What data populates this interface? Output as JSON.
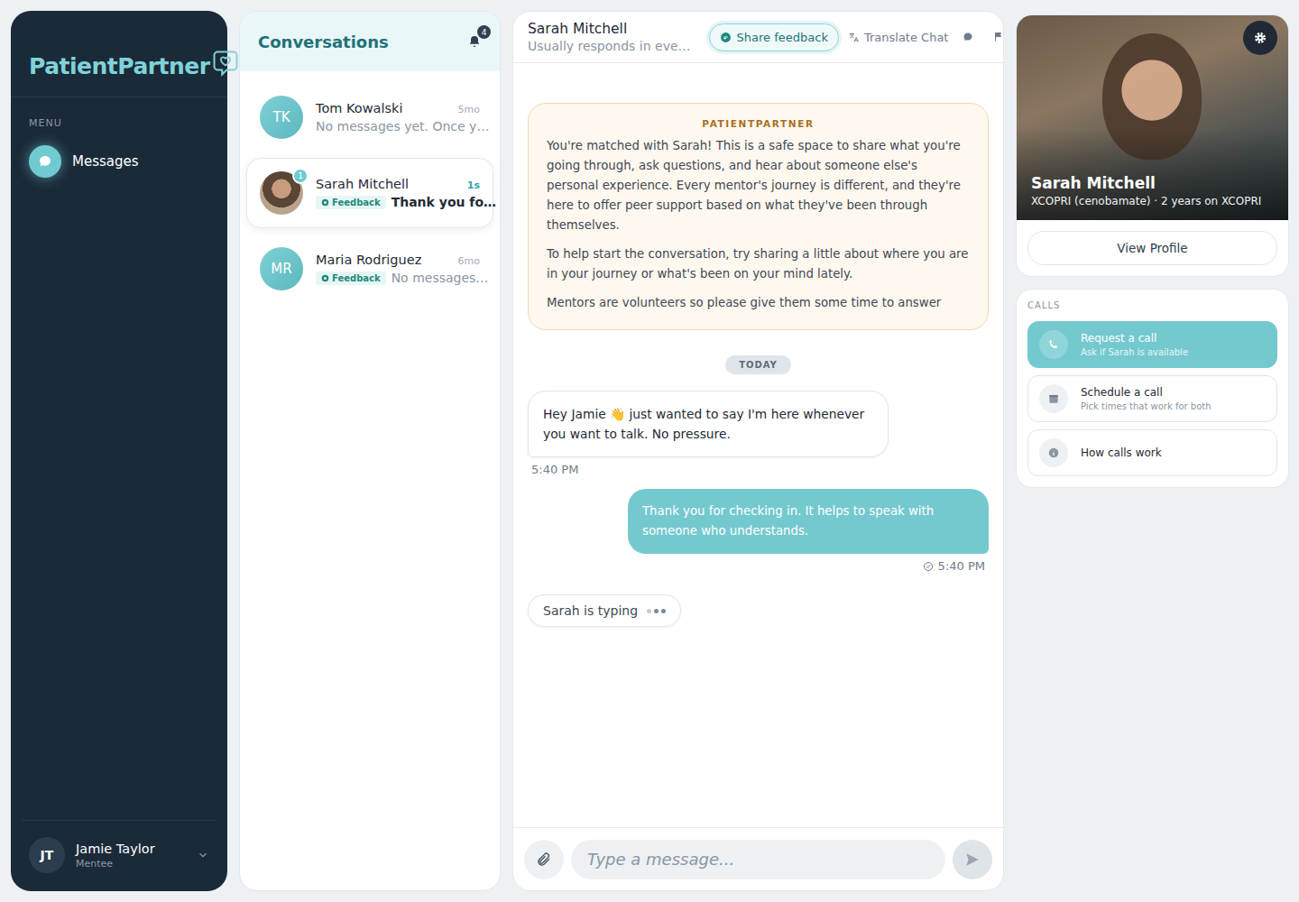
{
  "logo": "PatientPartner",
  "sidebar": {
    "menu_label": "MENU",
    "items": [
      {
        "label": "Messages",
        "selected": true
      }
    ],
    "user": {
      "initials": "JT",
      "name": "Jamie Taylor",
      "role": "Mentee"
    }
  },
  "conversations": {
    "title": "Conversations",
    "notification_count": "4",
    "items": [
      {
        "kind": "initials",
        "initials": "TK",
        "name": "Tom Kowalski",
        "time": "5mo",
        "preview": "No messages yet. Once y…",
        "selected": false,
        "unread": false
      },
      {
        "kind": "photo",
        "badge": "1",
        "name": "Sarah Mitchell",
        "time": "1s",
        "feedback": "Feedback",
        "preview": "Thank you fo…",
        "selected": true,
        "unread": true
      },
      {
        "kind": "initials",
        "initials": "MR",
        "name": "Maria Rodriguez",
        "time": "6mo",
        "feedback": "Feedback",
        "preview": "No messages…",
        "selected": false,
        "unread": false
      }
    ]
  },
  "chat": {
    "name": "Sarah Mitchell",
    "subtitle": "Usually responds in eve…",
    "share_feedback": "Share feedback",
    "translate": "Translate Chat",
    "notice": {
      "title": "PATIENTPARTNER",
      "paragraphs": [
        "You're matched with Sarah! This is a safe space to share what you're going through, ask questions, and hear about someone else's personal experience. Every mentor's journey is different, and they're here to offer peer support based on what they've been through themselves.",
        "To help start the conversation, try sharing a little about where you are in your journey or what's been on your mind lately.",
        "Mentors are volunteers so please give them some time to answer"
      ]
    },
    "date_divider": "TODAY",
    "messages": [
      {
        "kind": "incoming",
        "text": "Hey Jamie 👋 just wanted to say I'm here whenever you want to talk. No pressure.",
        "time": "5:40 PM"
      },
      {
        "kind": "outgoing",
        "text": "Thank you for checking in. It helps to speak with someone who understands.",
        "time": "5:40 PM",
        "read": true
      }
    ],
    "typing": "Sarah is typing",
    "composer": {
      "placeholder": "Type a message..."
    }
  },
  "profile": {
    "name": "Sarah Mitchell",
    "detail": "XCOPRI (cenobamate) · 2 years on XCOPRI",
    "button": "View Profile"
  },
  "calls": {
    "label": "CALLS",
    "items": [
      {
        "kind": "phone",
        "title": "Request a call",
        "subtitle": "Ask if Sarah is available",
        "selected": true
      },
      {
        "kind": "calendar",
        "title": "Schedule a call",
        "subtitle": "Pick times that work for both",
        "selected": false
      },
      {
        "kind": "info",
        "title": "How calls work",
        "selected": false
      }
    ]
  }
}
